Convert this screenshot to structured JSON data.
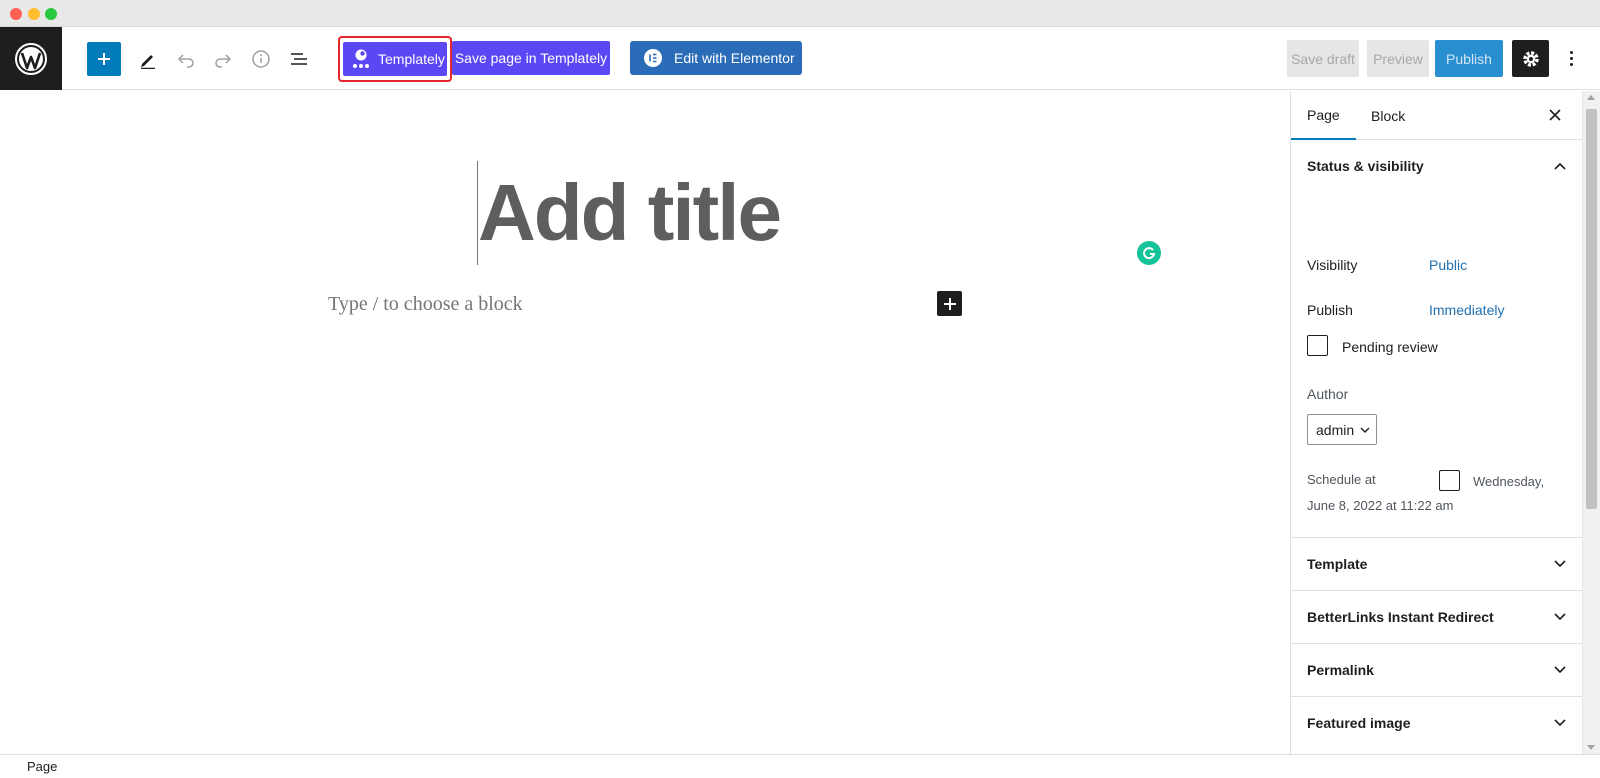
{
  "toolbar": {
    "templately_label": "Templately",
    "save_templately_label": "Save page in Templately",
    "elementor_label": "Edit with Elementor",
    "save_draft_label": "Save draft",
    "preview_label": "Preview",
    "publish_label": "Publish"
  },
  "editor": {
    "title_placeholder": "Add title",
    "block_placeholder": "Type / to choose a block"
  },
  "sidebar": {
    "tabs": [
      {
        "label": "Page"
      },
      {
        "label": "Block"
      }
    ],
    "status_panel": {
      "title": "Status & visibility",
      "visibility_label": "Visibility",
      "visibility_value": "Public",
      "publish_label": "Publish",
      "publish_value": "Immediately",
      "pending_label": "Pending review",
      "author_label": "Author",
      "author_value": "admin",
      "schedule_label": "Schedule at",
      "schedule_value_1": "Wednesday,",
      "schedule_value_2": "June 8, 2022 at 11:22 am"
    },
    "panels": [
      {
        "title": "Template"
      },
      {
        "title": "BetterLinks Instant Redirect"
      },
      {
        "title": "Permalink"
      },
      {
        "title": "Featured image"
      }
    ]
  },
  "footer": {
    "breadcrumb": "Page"
  },
  "colors": {
    "wp_blue": "#007cba",
    "templately_purple": "#5b48f5",
    "elementor_blue": "#2b6cb8",
    "highlight_red": "#e3262f",
    "grammarly_green": "#15c39a"
  }
}
